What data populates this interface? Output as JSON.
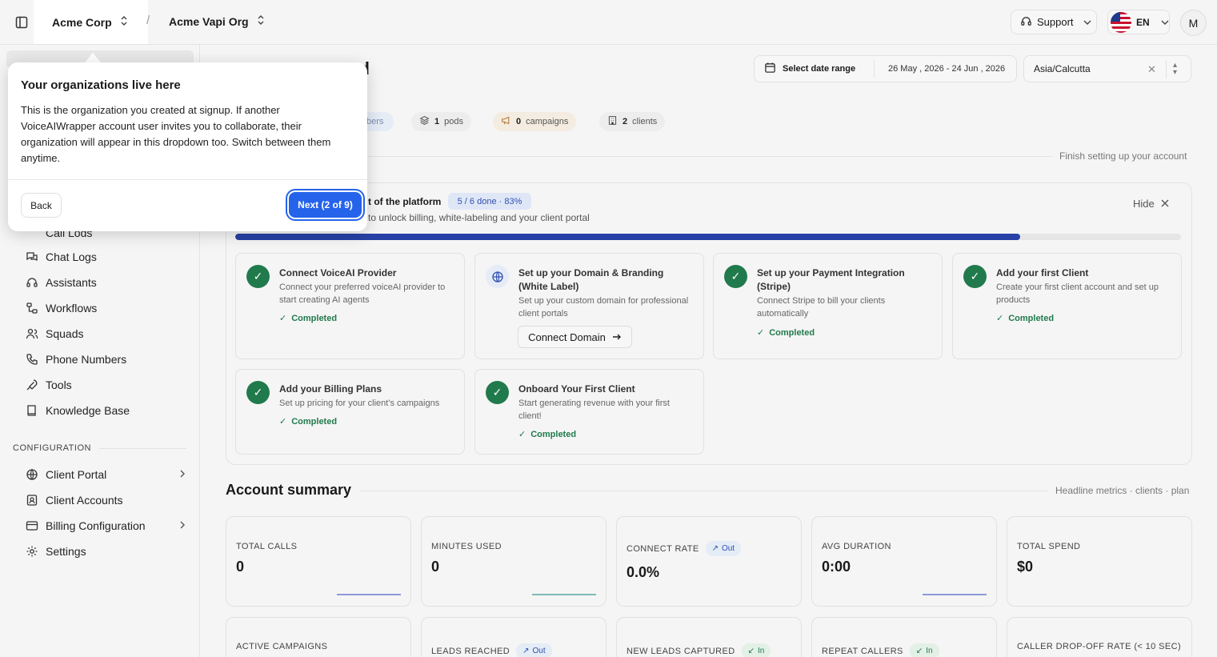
{
  "topbar": {
    "org": "Acme Corp",
    "separator": "/",
    "sub_org": "Acme Vapi Org",
    "support": "Support",
    "lang": "EN",
    "avatar": "M"
  },
  "sidebar": {
    "partial_item": "Call Logs",
    "items": [
      {
        "label": "Chat Logs",
        "icon": "chat-icon"
      },
      {
        "label": "Assistants",
        "icon": "headset-icon"
      },
      {
        "label": "Workflows",
        "icon": "workflow-icon"
      },
      {
        "label": "Squads",
        "icon": "users-icon"
      },
      {
        "label": "Phone Numbers",
        "icon": "phone-icon"
      },
      {
        "label": "Tools",
        "icon": "wrench-icon"
      },
      {
        "label": "Knowledge Base",
        "icon": "book-icon"
      }
    ],
    "section": "CONFIGURATION",
    "config_items": [
      {
        "label": "Client Portal",
        "icon": "globe-icon",
        "has_chevron": true
      },
      {
        "label": "Client Accounts",
        "icon": "contact-icon",
        "has_chevron": false
      },
      {
        "label": "Billing Configuration",
        "icon": "card-icon",
        "has_chevron": true
      },
      {
        "label": "Settings",
        "icon": "gear-icon",
        "has_chevron": false
      }
    ]
  },
  "header": {
    "title_partial": "rd",
    "date_label": "Select date range",
    "date_range": "26 May , 2026 - 24 Jun , 2026",
    "timezone": "Asia/Calcutta"
  },
  "stats": {
    "members_partial": "bers",
    "pods_count": "1",
    "pods_label": "pods",
    "campaigns_count": "0",
    "campaigns_label": "campaigns",
    "clients_count": "2",
    "clients_label": "clients"
  },
  "onboarding": {
    "finish_label": "Finish setting up your account",
    "title_partial": "t of the platform",
    "badge": "5 / 6 done · 83%",
    "subtitle_partial": "to unlock billing, white-labeling and your client portal",
    "hide": "Hide",
    "progress_pct": 83,
    "tasks": [
      {
        "title": "Connect VoiceAI Provider",
        "desc": "Connect your preferred voiceAI provider to start creating AI agents",
        "status": "Completed"
      },
      {
        "title": "Set up your Domain & Branding (White Label)",
        "desc": "Set up your custom domain for professional client portals",
        "button": "Connect Domain"
      },
      {
        "title": "Set up your Payment Integration (Stripe)",
        "desc": "Connect Stripe to bill your clients automatically",
        "status": "Completed"
      },
      {
        "title": "Add your first Client",
        "desc": "Create your first client account and set up products",
        "status": "Completed"
      },
      {
        "title": "Add your Billing Plans",
        "desc": "Set up pricing for your client's campaigns",
        "status": "Completed"
      },
      {
        "title": "Onboard Your First Client",
        "desc": "Start generating revenue with your first client!",
        "status": "Completed"
      }
    ]
  },
  "summary": {
    "title": "Account summary",
    "subtitle": "Headline metrics · clients · plan",
    "metrics": [
      {
        "label": "TOTAL CALLS",
        "value": "0"
      },
      {
        "label": "MINUTES USED",
        "value": "0"
      },
      {
        "label": "CONNECT RATE",
        "value": "0.0%",
        "badge": "Out"
      },
      {
        "label": "AVG DURATION",
        "value": "0:00"
      },
      {
        "label": "TOTAL SPEND",
        "value": "$0"
      }
    ],
    "metrics_row2": [
      {
        "label": "ACTIVE CAMPAIGNS"
      },
      {
        "label": "LEADS REACHED",
        "badge": "Out"
      },
      {
        "label": "NEW LEADS CAPTURED",
        "badge": "In"
      },
      {
        "label": "REPEAT CALLERS",
        "badge": "In"
      },
      {
        "label": "CALLER DROP-OFF RATE (< 10 SEC)"
      }
    ]
  },
  "tour": {
    "title": "Your organizations live here",
    "body": "This is the organization you created at signup. If another VoiceAIWrapper account user invites you to collaborate, their organization will appear in this dropdown too. Switch between them anytime.",
    "back": "Back",
    "next": "Next (2 of 9)"
  },
  "colors": {
    "accent": "#2563eb",
    "progress": "#2741a6",
    "success": "#207a4c"
  }
}
